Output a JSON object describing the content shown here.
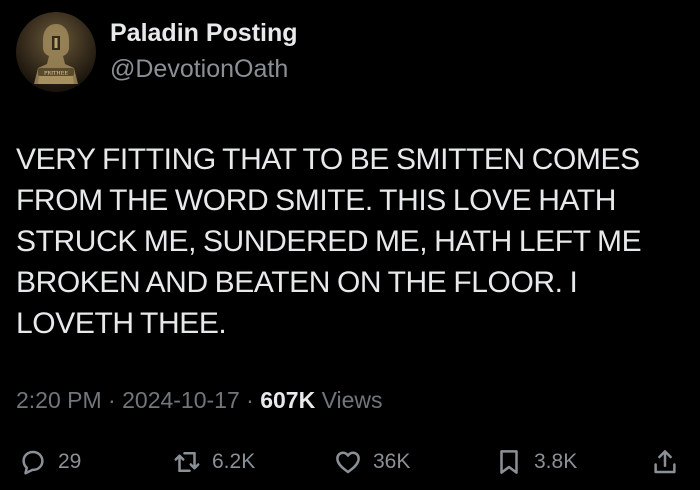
{
  "author": {
    "display_name": "Paladin Posting",
    "handle": "@DevotionOath",
    "avatar_icon": "paladin-avatar-icon",
    "avatar_banner_text": "PRITHEE"
  },
  "post": {
    "text": "VERY FITTING THAT TO BE SMITTEN COMES FROM THE WORD SMITE. THIS LOVE HATH STRUCK ME, SUNDERED ME, HATH LEFT ME BROKEN AND BEATEN ON THE FLOOR. I LOVETH THEE.",
    "time": "2:20 PM",
    "separator": "·",
    "date": "2024-10-17",
    "views_count": "607K",
    "views_label": "Views"
  },
  "actions": {
    "reply_count": "29",
    "retweet_count": "6.2K",
    "like_count": "36K",
    "bookmark_count": "3.8K"
  },
  "colors": {
    "background": "#000000",
    "primary_text": "#e7e9ea",
    "secondary_text": "#71767b"
  }
}
